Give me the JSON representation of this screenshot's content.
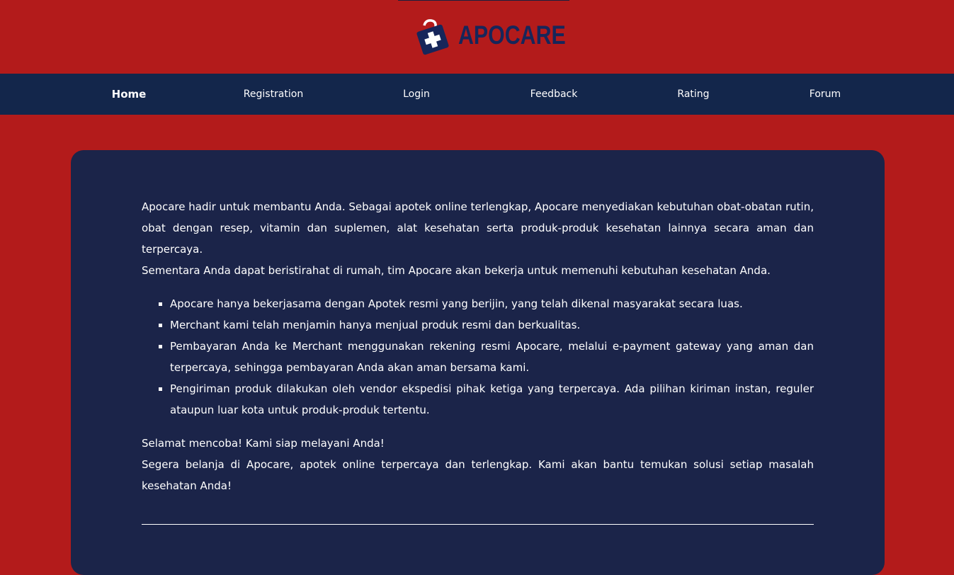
{
  "brand": {
    "name": "APOCARE",
    "colors": {
      "background": "#b31b1b",
      "nav": "#13264b",
      "card": "#1b2449",
      "logo_text": "#17265a"
    }
  },
  "nav": {
    "items": [
      {
        "label": "Home",
        "active": true
      },
      {
        "label": "Registration",
        "active": false
      },
      {
        "label": "Login",
        "active": false
      },
      {
        "label": "Feedback",
        "active": false
      },
      {
        "label": "Rating",
        "active": false
      },
      {
        "label": "Forum",
        "active": false
      }
    ]
  },
  "main": {
    "intro_1": "Apocare hadir untuk membantu Anda. Sebagai apotek online terlengkap, Apocare menyediakan kebutuhan obat-obatan rutin, obat dengan resep, vitamin dan suplemen, alat kesehatan serta produk-produk kesehatan lainnya secara aman dan terpercaya.",
    "intro_2": "Sementara Anda dapat beristirahat di rumah, tim Apocare akan bekerja untuk memenuhi kebutuhan kesehatan Anda.",
    "bullets": [
      "Apocare hanya bekerjasama dengan Apotek resmi yang berijin, yang telah dikenal masyarakat secara luas.",
      "Merchant kami telah menjamin hanya menjual produk resmi dan berkualitas.",
      "Pembayaran Anda ke Merchant menggunakan rekening resmi Apocare, melalui e-payment gateway yang aman dan terpercaya, sehingga pembayaran Anda akan aman bersama kami.",
      "Pengiriman produk dilakukan oleh vendor ekspedisi pihak ketiga yang terpercaya. Ada pilihan kiriman instan, reguler ataupun luar kota untuk produk-produk tertentu."
    ],
    "closing_1": "Selamat mencoba! Kami siap melayani Anda!",
    "closing_2": "Segera belanja di Apocare, apotek online terpercaya dan terlengkap. Kami akan bantu temukan solusi setiap masalah kesehatan Anda!"
  }
}
